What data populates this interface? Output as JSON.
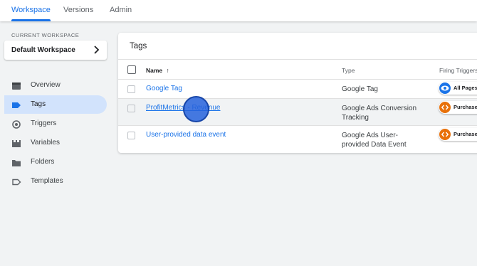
{
  "topnav": {
    "tabs": [
      {
        "label": "Workspace"
      },
      {
        "label": "Versions"
      },
      {
        "label": "Admin"
      }
    ]
  },
  "sidebar": {
    "workspace_label": "CURRENT WORKSPACE",
    "workspace_name": "Default Workspace",
    "items": [
      {
        "label": "Overview",
        "icon": "overview-icon"
      },
      {
        "label": "Tags",
        "icon": "tag-icon"
      },
      {
        "label": "Triggers",
        "icon": "trigger-icon"
      },
      {
        "label": "Variables",
        "icon": "variables-icon"
      },
      {
        "label": "Folders",
        "icon": "folder-icon"
      },
      {
        "label": "Templates",
        "icon": "template-icon"
      }
    ]
  },
  "tags_table": {
    "title": "Tags",
    "headers": {
      "name": "Name",
      "sort_arrow": "↑",
      "type": "Type",
      "firing": "Firing Triggers"
    },
    "rows": [
      {
        "name": "Google Tag",
        "type": "Google Tag",
        "trigger": "All Pages",
        "trigger_color": "#1a73e8"
      },
      {
        "name": "ProfitMetrics - Revenue",
        "type": "Google Ads Conversion Tracking",
        "trigger": "Purchase",
        "trigger_color": "#e8710a"
      },
      {
        "name": "User-provided data event",
        "type": "Google Ads User-provided Data Event",
        "trigger": "Purchase",
        "trigger_color": "#e8710a"
      }
    ]
  },
  "colors": {
    "accent": "#1a73e8",
    "active_nav_bg": "#d2e3fc",
    "trigger_blue": "#1a73e8",
    "trigger_orange": "#e8710a"
  }
}
